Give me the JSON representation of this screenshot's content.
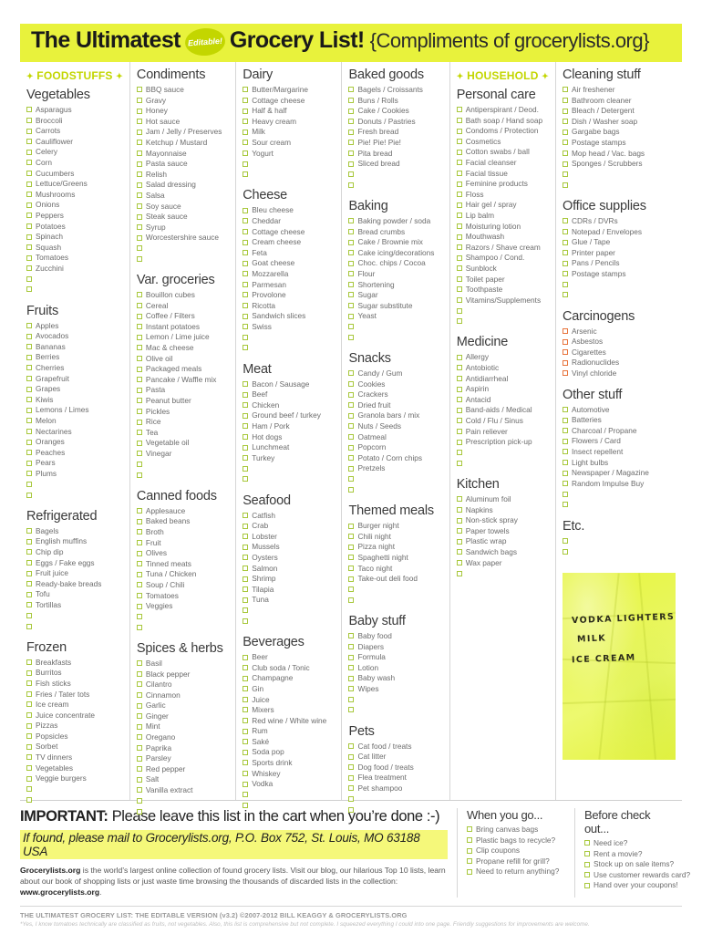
{
  "header": {
    "title_bold": "The Ultimatest",
    "badge": "Editable!",
    "title_bold2": "Grocery List!",
    "compliments": "{Compliments of grocerylists.org}"
  },
  "banners": {
    "foodstuffs": "FOODSTUFFS",
    "household": "HOUSEHOLD"
  },
  "columns": [
    {
      "id": "col-foodstuffs",
      "banner": "FOODSTUFFS",
      "sections": [
        {
          "title": "Vegetables",
          "items": [
            "Asparagus",
            "Broccoli",
            "Carrots",
            "Cauliflower",
            "Celery",
            "Corn",
            "Cucumbers",
            "Lettuce/Greens",
            "Mushrooms",
            "Onions",
            "Peppers",
            "Potatoes",
            "Spinach",
            "Squash",
            "Tomatoes",
            "Zucchini"
          ],
          "blanks": 2
        },
        {
          "title": "Fruits",
          "items": [
            "Apples",
            "Avocados",
            "Bananas",
            "Berries",
            "Cherries",
            "Grapefruit",
            "Grapes",
            "Kiwis",
            "Lemons / Limes",
            "Melon",
            "Nectarines",
            "Oranges",
            "Peaches",
            "Pears",
            "Plums"
          ],
          "blanks": 2
        },
        {
          "title": "Refrigerated",
          "items": [
            "Bagels",
            "English muffins",
            "Chip dip",
            "Eggs / Fake eggs",
            "Fruit juice",
            "Ready-bake breads",
            "Tofu",
            "Tortillas"
          ],
          "blanks": 2
        },
        {
          "title": "Frozen",
          "items": [
            "Breakfasts",
            "Burritos",
            "Fish sticks",
            "Fries / Tater tots",
            "Ice cream",
            "Juice concentrate",
            "Pizzas",
            "Popsicles",
            "Sorbet",
            "TV dinners",
            "Vegetables",
            "Veggie burgers"
          ],
          "blanks": 2
        }
      ]
    },
    {
      "id": "col-condiments",
      "sections": [
        {
          "title": "Condiments",
          "items": [
            "BBQ sauce",
            "Gravy",
            "Honey",
            "Hot sauce",
            "Jam / Jelly / Preserves",
            "Ketchup / Mustard",
            "Mayonnaise",
            "Pasta sauce",
            "Relish",
            "Salad dressing",
            "Salsa",
            "Soy sauce",
            "Steak sauce",
            "Syrup",
            "Worcestershire sauce"
          ],
          "blanks": 2
        },
        {
          "title": "Var. groceries",
          "items": [
            "Bouillon cubes",
            "Cereal",
            "Coffee / Filters",
            "Instant potatoes",
            "Lemon / Lime juice",
            "Mac & cheese",
            "Olive oil",
            "Packaged meals",
            "Pancake / Waffle mix",
            "Pasta",
            "Peanut butter",
            "Pickles",
            "Rice",
            "Tea",
            "Vegetable oil",
            "Vinegar"
          ],
          "blanks": 2
        },
        {
          "title": "Canned foods",
          "items": [
            "Applesauce",
            "Baked beans",
            "Broth",
            "Fruit",
            "Olives",
            "Tinned meats",
            "Tuna / Chicken",
            "Soup / Chili",
            "Tomatoes",
            "Veggies"
          ],
          "blanks": 2
        },
        {
          "title": "Spices & herbs",
          "items": [
            "Basil",
            "Black pepper",
            "Cilantro",
            "Cinnamon",
            "Garlic",
            "Ginger",
            "Mint",
            "Oregano",
            "Paprika",
            "Parsley",
            "Red pepper",
            "Salt",
            "Vanilla extract"
          ],
          "blanks": 2
        }
      ]
    },
    {
      "id": "col-dairy",
      "sections": [
        {
          "title": "Dairy",
          "items": [
            "Butter/Margarine",
            "Cottage cheese",
            "Half & half",
            "Heavy cream",
            "Milk",
            "Sour cream",
            "Yogurt"
          ],
          "blanks": 2
        },
        {
          "title": "Cheese",
          "items": [
            "Bleu cheese",
            "Cheddar",
            "Cottage cheese",
            "Cream cheese",
            "Feta",
            "Goat cheese",
            "Mozzarella",
            "Parmesan",
            "Provolone",
            "Ricotta",
            "Sandwich slices",
            "Swiss"
          ],
          "blanks": 2
        },
        {
          "title": "Meat",
          "items": [
            "Bacon / Sausage",
            "Beef",
            "Chicken",
            "Ground beef / turkey",
            "Ham / Pork",
            "Hot dogs",
            "Lunchmeat",
            "Turkey"
          ],
          "blanks": 2
        },
        {
          "title": "Seafood",
          "items": [
            "Catfish",
            "Crab",
            "Lobster",
            "Mussels",
            "Oysters",
            "Salmon",
            "Shrimp",
            "Tilapia",
            "Tuna"
          ],
          "blanks": 2
        },
        {
          "title": "Beverages",
          "items": [
            "Beer",
            "Club soda / Tonic",
            "Champagne",
            "Gin",
            "Juice",
            "Mixers",
            "Red wine / White wine",
            "Rum",
            "Saké",
            "Soda pop",
            "Sports drink",
            "Whiskey",
            "Vodka"
          ],
          "blanks": 2
        }
      ]
    },
    {
      "id": "col-baked",
      "sections": [
        {
          "title": "Baked goods",
          "items": [
            "Bagels / Croissants",
            "Buns / Rolls",
            "Cake / Cookies",
            "Donuts / Pastries",
            "Fresh bread",
            "Pie! Pie! Pie!",
            "Pita bread",
            "Sliced bread"
          ],
          "blanks": 2
        },
        {
          "title": "Baking",
          "items": [
            "Baking powder / soda",
            "Bread crumbs",
            "Cake / Brownie mix",
            "Cake icing/decorations",
            "Choc. chips / Cocoa",
            "Flour",
            "Shortening",
            "Sugar",
            "Sugar substitute",
            "Yeast"
          ],
          "blanks": 2
        },
        {
          "title": "Snacks",
          "items": [
            "Candy / Gum",
            "Cookies",
            "Crackers",
            "Dried fruit",
            "Granola bars / mix",
            "Nuts / Seeds",
            "Oatmeal",
            "Popcorn",
            "Potato / Corn chips",
            "Pretzels"
          ],
          "blanks": 2
        },
        {
          "title": "Themed meals",
          "items": [
            "Burger night",
            "Chili night",
            "Pizza night",
            "Spaghetti night",
            "Taco night",
            "Take-out deli food"
          ],
          "blanks": 2
        },
        {
          "title": "Baby stuff",
          "items": [
            "Baby food",
            "Diapers",
            "Formula",
            "Lotion",
            "Baby wash",
            "Wipes"
          ],
          "blanks": 2
        },
        {
          "title": "Pets",
          "items": [
            "Cat food / treats",
            "Cat litter",
            "Dog food / treats",
            "Flea treatment",
            "Pet shampoo"
          ],
          "blanks": 2
        }
      ]
    },
    {
      "id": "col-household",
      "banner": "HOUSEHOLD",
      "sections": [
        {
          "title": "Personal care",
          "items": [
            "Antiperspirant / Deod.",
            "Bath soap / Hand soap",
            "Condoms / Protection",
            "Cosmetics",
            "Cotton swabs / ball",
            "Facial cleanser",
            "Facial tissue",
            "Feminine products",
            "Floss",
            "Hair gel / spray",
            "Lip balm",
            "Moisturing lotion",
            "Mouthwash",
            "Razors / Shave cream",
            "Shampoo / Cond.",
            "Sunblock",
            "Toilet paper",
            "Toothpaste",
            "Vitamins/Supplements"
          ],
          "blanks": 2
        },
        {
          "title": "Medicine",
          "items": [
            "Allergy",
            "Antobiotic",
            "Antidiarrheal",
            "Aspirin",
            "Antacid",
            "Band-aids / Medical",
            "Cold / Flu / Sinus",
            "Pain reliever",
            "Prescription pick-up"
          ],
          "blanks": 2
        },
        {
          "title": "Kitchen",
          "items": [
            "Aluminum foil",
            "Napkins",
            "Non-stick spray",
            "Paper towels",
            "Plastic wrap",
            "Sandwich bags",
            "Wax paper"
          ],
          "blanks": 1
        }
      ]
    },
    {
      "id": "col-cleaning",
      "sections": [
        {
          "title": "Cleaning stuff",
          "items": [
            "Air freshener",
            "Bathroom cleaner",
            "Bleach / Detergent",
            "Dish / Washer soap",
            "Gargabe bags",
            "Postage stamps",
            "Mop head / Vac. bags",
            "Sponges / Scrubbers"
          ],
          "blanks": 2
        },
        {
          "title": "Office supplies",
          "items": [
            "CDRs / DVRs",
            "Notepad / Envelopes",
            "Glue / Tape",
            "Printer paper",
            "Pans / Pencils",
            "Postage stamps"
          ],
          "blanks": 2
        },
        {
          "title": "Carcinogens",
          "items": [
            "Arsenic",
            "Asbestos",
            "Cigarettes",
            "Radionuclides",
            "Vinyl chloride"
          ],
          "blanks": 0,
          "box_color": "red"
        },
        {
          "title": "Other stuff",
          "items": [
            "Automotive",
            "Batteries",
            "Charcoal / Propane",
            "Flowers / Card",
            "Insect repellent",
            "Light bulbs",
            "Newspaper / Magazine",
            "Random Impulse Buy"
          ],
          "blanks": 2
        },
        {
          "title": "Etc.",
          "items": [],
          "blanks": 2
        }
      ]
    }
  ],
  "sticky_note": {
    "lines": [
      "VODKA    LIGHTERS",
      "MILK",
      "ICE CREAM"
    ]
  },
  "footer": {
    "important_bold": "IMPORTANT:",
    "important_rest": " Please leave this list in the cart when you’re done :-)",
    "mail_line": "If found, please mail to Grocerylists.org, P.O. Box 752, St. Louis, MO 63188 USA",
    "blurb_1": "Grocerylists.org",
    "blurb_2": " is the world’s largest online collection of found grocery lists. Visit our blog, our hilarious Top 10 lists, learn about our book of shopping lists or just waste time browsing the thousands of discarded lists in the collection: ",
    "blurb_3": "www.grocerylists.org",
    "blurb_4": ".",
    "boxes": [
      {
        "title": "When you go...",
        "items": [
          "Bring canvas bags",
          "Plastic bags to recycle?",
          "Clip coupons",
          "Propane refill for grill?",
          "Need to return anything?"
        ]
      },
      {
        "title": "Before check out...",
        "items": [
          "Need ice?",
          "Rent a movie?",
          "Stock up on sale items?",
          "Use customer rewards card?",
          "Hand over your coupons!"
        ]
      }
    ]
  },
  "colophon": {
    "line1": "THE ULTIMATEST GROCERY LIST: THE EDITABLE VERSION (v3.2) ©2007-2012 BILL KEAGGY & GROCERYLISTS.ORG",
    "line2": "*Yes, I know tomatoes technically are classified as fruits, not vegetables. Also, this list is comprehensive but not complete. I squeezed everything I could into one page. Friendly suggestions for improvements are welcome."
  }
}
